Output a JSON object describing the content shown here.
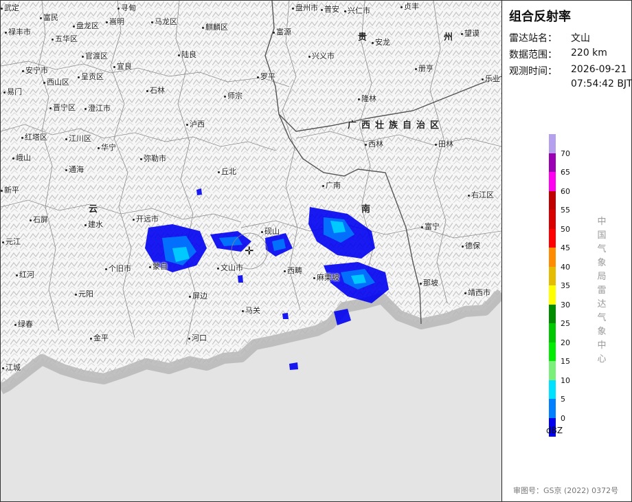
{
  "panel": {
    "title": "组合反射率",
    "station_label": "雷达站名：",
    "station_value": "文山",
    "range_label": "数据范围：",
    "range_value": "220 km",
    "time_label": "观测时间：",
    "time_date": "2026-09-21",
    "time_clock": "07:54:42 BJT",
    "legend_unit": "dBZ",
    "legend_ticks": [
      "70",
      "65",
      "60",
      "55",
      "50",
      "45",
      "40",
      "35",
      "30",
      "25",
      "20",
      "15",
      "10",
      "5",
      "0"
    ],
    "legend_colors": [
      "#b4a0ec",
      "#9c00b4",
      "#ff00f0",
      "#c00000",
      "#d80000",
      "#ff0000",
      "#ff8c00",
      "#e6bc00",
      "#ffff00",
      "#008c00",
      "#00c800",
      "#00ec00",
      "#7af07a",
      "#00e0ff",
      "#0080ff",
      "#0000f0"
    ],
    "org": "中国气象局雷达气象中心",
    "approval": "审图号：GS京 (2022) 0372号"
  },
  "map": {
    "radar_site_icon": "crosshair-icon",
    "provinces": [
      "贵",
      "州",
      "广西壮族自治区",
      "云",
      "南"
    ],
    "places": [
      "武定",
      "寻甸",
      "盘州市",
      "普安",
      "兴仁市",
      "贞丰",
      "富民",
      "嵩明",
      "马龙区",
      "麒麟区",
      "禄丰市",
      "五华区",
      "盘龙区",
      "富源",
      "安龙",
      "望谟",
      "官渡区",
      "陆良",
      "兴义市",
      "册亨",
      "安宁市",
      "呈贡区",
      "宜良",
      "罗平",
      "乐业",
      "易门",
      "西山区",
      "石林",
      "师宗",
      "隆林",
      "晋宁区",
      "澄江市",
      "泸西",
      "西林",
      "田林",
      "峨山",
      "江川区",
      "红塔区",
      "华宁",
      "弥勒市",
      "通海",
      "丘北",
      "广南",
      "右江区",
      "新平",
      "石屏",
      "建水",
      "开远市",
      "砚山",
      "富宁",
      "元江",
      "个旧市",
      "蒙自",
      "文山市",
      "西畴",
      "麻栗坡",
      "德保",
      "红河",
      "那坡",
      "元阳",
      "屏边",
      "马关",
      "靖西市",
      "绿春",
      "金平",
      "河口",
      "江城"
    ]
  }
}
